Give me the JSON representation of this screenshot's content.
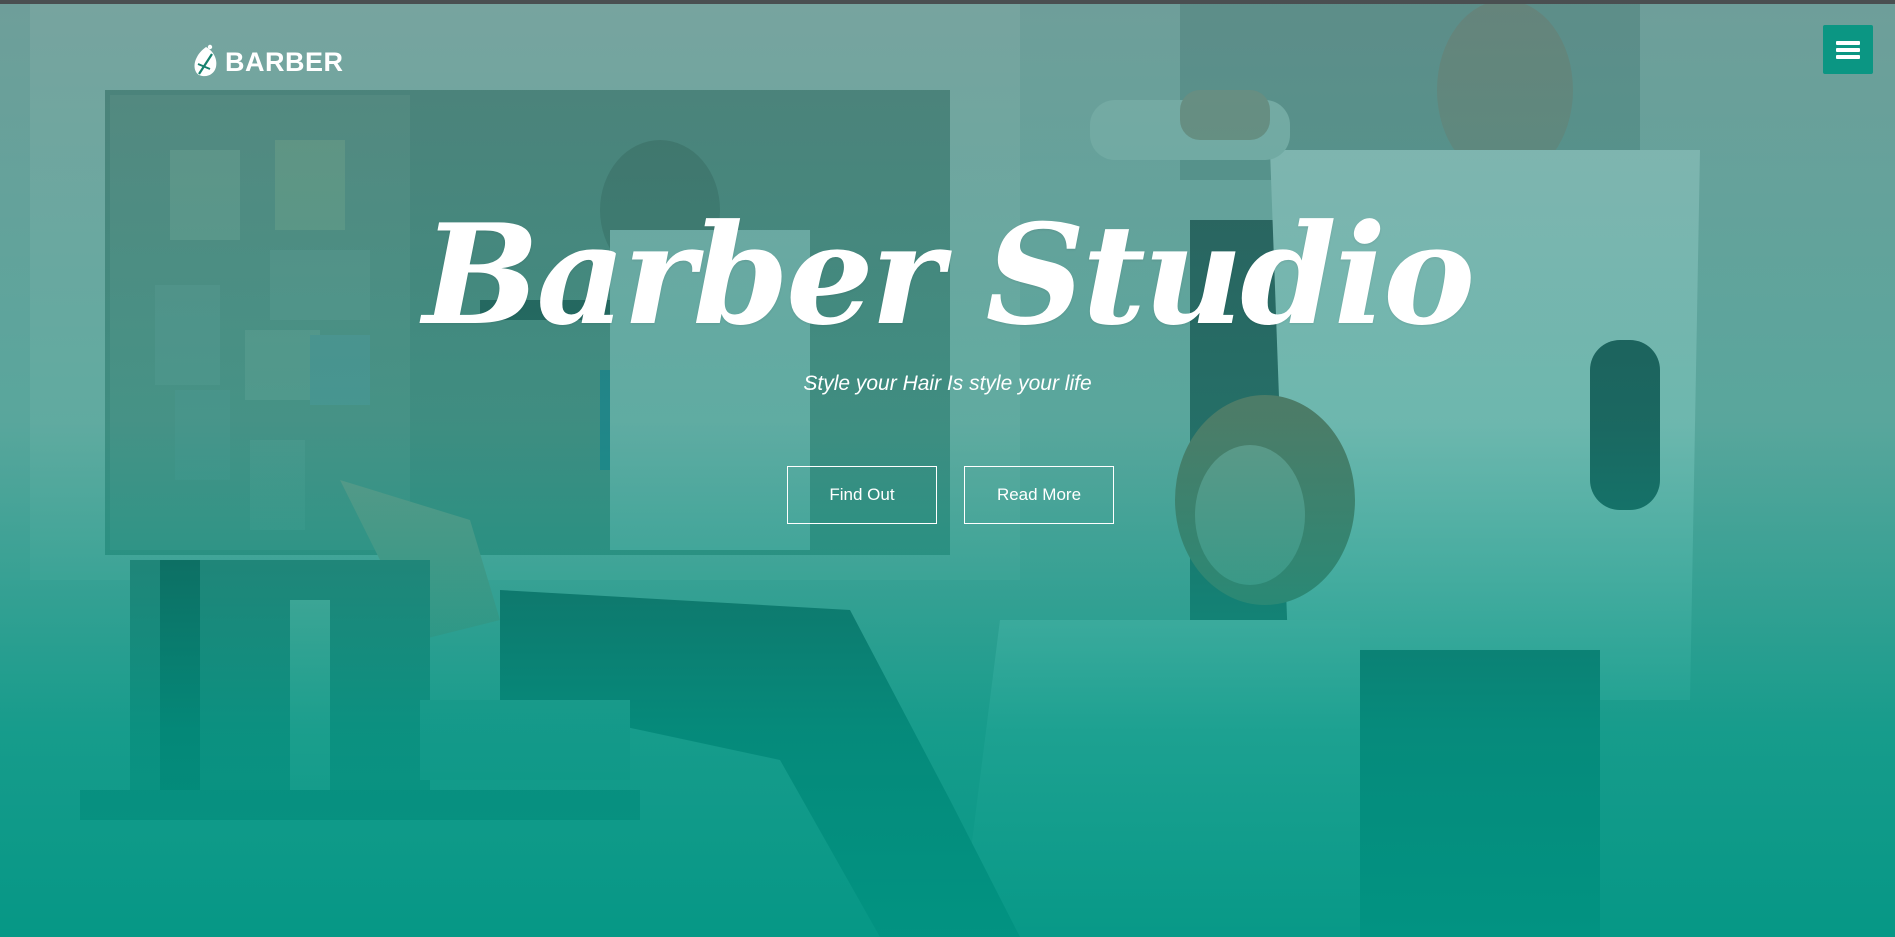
{
  "brand": {
    "logo_text": "BARBER",
    "logo_icon": "barber-leaf-logo-icon"
  },
  "menu": {
    "icon": "hamburger-menu-icon"
  },
  "hero": {
    "title": "Barber Studio",
    "subtitle": "Style your Hair Is style your life",
    "buttons": {
      "find_out": "Find Out",
      "read_more": "Read More"
    }
  },
  "colors": {
    "accent": "#0b9683",
    "overlay_teal": "#009684",
    "text": "#ffffff",
    "topbar": "#4a4f51"
  }
}
